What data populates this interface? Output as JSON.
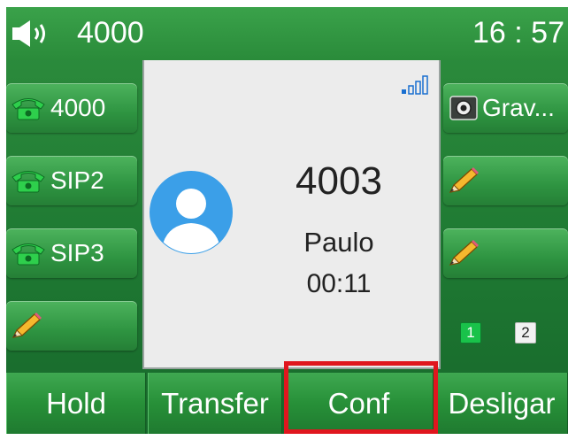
{
  "status": {
    "extension": "4000",
    "time": "16 : 57",
    "speaker_icon": "speaker-icon"
  },
  "left_keys": [
    {
      "label": "4000",
      "icon": "phone-icon"
    },
    {
      "label": "SIP2",
      "icon": "phone-icon"
    },
    {
      "label": "SIP3",
      "icon": "phone-icon"
    },
    {
      "label": "",
      "icon": "pencil-icon"
    }
  ],
  "right_keys": [
    {
      "label": "Grav...",
      "icon": "record-icon"
    },
    {
      "label": "",
      "icon": "pencil-icon"
    },
    {
      "label": "",
      "icon": "pencil-icon"
    }
  ],
  "call": {
    "number": "4003",
    "name": "Paulo",
    "timer": "00:11"
  },
  "pages": {
    "page1": "1",
    "page2": "2"
  },
  "softkeys": {
    "hold": "Hold",
    "transfer": "Transfer",
    "conf": "Conf",
    "desligar": "Desligar"
  },
  "colors": {
    "background_green": "#1f7a33",
    "highlight_red": "#e0161e",
    "avatar_blue": "#3b9fe8"
  }
}
